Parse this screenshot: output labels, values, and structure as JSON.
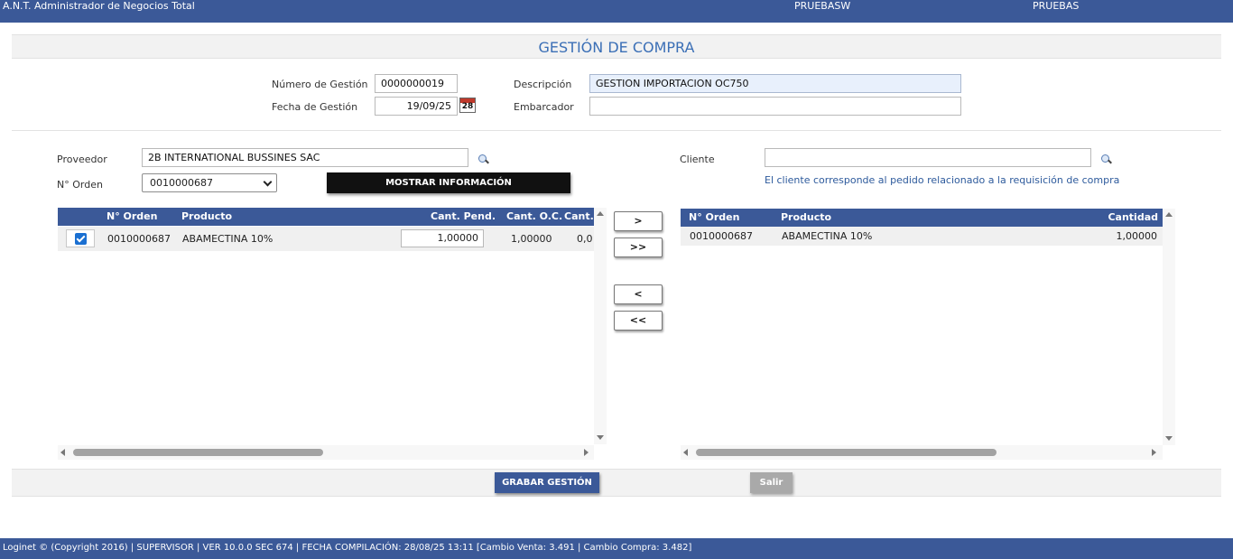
{
  "header": {
    "app_title": "A.N.T. Administrador de Negocios Total",
    "server": "PRUEBASW",
    "database": "PRUEBAS"
  },
  "page_title": "GESTIÓN DE COMPRA",
  "form": {
    "numero_label": "Número de Gestión",
    "numero_value": "0000000019",
    "fecha_label": "Fecha de Gestión",
    "fecha_value": "19/09/25",
    "calendar_day": "28",
    "descripcion_label": "Descripción",
    "descripcion_value": "GESTION IMPORTACION OC750",
    "embarcador_label": "Embarcador",
    "embarcador_value": ""
  },
  "proveedor": {
    "label": "Proveedor",
    "value": "2B INTERNATIONAL BUSSINES SAC",
    "orden_label": "N° Orden",
    "orden_selected": "0010000687",
    "show_button": "MOSTRAR INFORMACIÓN"
  },
  "cliente": {
    "label": "Cliente",
    "value": "",
    "hint": "El cliente corresponde al pedido relacionado a la requisición de compra"
  },
  "left_grid": {
    "columns": [
      "N° Orden",
      "Producto",
      "Cant. Pend.",
      "Cant. O.C.",
      "Cant. "
    ],
    "rows": [
      {
        "checked": true,
        "orden": "0010000687",
        "producto": "ABAMECTINA 10%",
        "cant_pend": "1,00000",
        "cant_oc": "1,00000",
        "cant_extra": "0,0"
      }
    ]
  },
  "move_buttons": {
    "move_one": ">",
    "move_all": ">>",
    "back_one": "<",
    "back_all": "<<"
  },
  "right_grid": {
    "columns": [
      "N° Orden",
      "Producto",
      "Cantidad"
    ],
    "rows": [
      {
        "orden": "0010000687",
        "producto": "ABAMECTINA 10%",
        "cantidad": "1,00000"
      }
    ]
  },
  "actions": {
    "save": "GRABAR GESTIÓN",
    "exit": "Salir"
  },
  "footer": {
    "text": "Loginet © (Copyright 2016) | SUPERVISOR | VER 10.0.0 SEC 674 | FECHA COMPILACIÓN: 28/08/25 13:11 [Cambio Venta: 3.491 | Cambio Compra: 3.482]"
  },
  "colors": {
    "brand": "#3b5998",
    "title": "#3b6fb6",
    "hint": "#2d5a9c",
    "checkbox": "#1a6fd1"
  }
}
